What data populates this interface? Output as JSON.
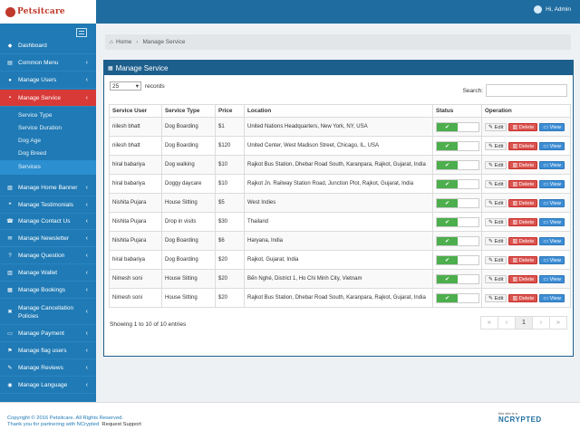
{
  "app": {
    "logo_text": "Petsitcare"
  },
  "header": {
    "user_label": "Hi, Admin"
  },
  "sidebar": {
    "items": [
      {
        "label": "Dashboard",
        "icon": "dashboard-icon",
        "chevron": false
      },
      {
        "label": "Common Menu",
        "icon": "list-icon",
        "chevron": true
      },
      {
        "label": "Manage Users",
        "icon": "users-icon",
        "chevron": true
      },
      {
        "label": "Manage Service",
        "icon": "service-icon",
        "chevron": true,
        "active": true
      },
      {
        "label": "Manage Home Banner",
        "icon": "image-icon",
        "chevron": true
      },
      {
        "label": "Manage Testimonials",
        "icon": "quote-icon",
        "chevron": true
      },
      {
        "label": "Manage Contact Us",
        "icon": "phone-icon",
        "chevron": true
      },
      {
        "label": "Manage Newsletter",
        "icon": "envelope-icon",
        "chevron": true
      },
      {
        "label": "Manage Question",
        "icon": "question-icon",
        "chevron": true
      },
      {
        "label": "Manage Wallet",
        "icon": "wallet-icon",
        "chevron": true
      },
      {
        "label": "Manage Bookings",
        "icon": "calendar-icon",
        "chevron": true
      },
      {
        "label": "Manage Cancellation Policies",
        "icon": "cancel-icon",
        "chevron": true
      },
      {
        "label": "Manage Payment",
        "icon": "payment-icon",
        "chevron": true
      },
      {
        "label": "Manage flag users",
        "icon": "flag-icon",
        "chevron": true
      },
      {
        "label": "Manage Reviews",
        "icon": "comment-icon",
        "chevron": true
      },
      {
        "label": "Manage Language",
        "icon": "globe-icon",
        "chevron": true
      }
    ],
    "subitems": [
      "Service Type",
      "Service Duration",
      "Dog Age",
      "Dog Breed",
      "Services"
    ]
  },
  "breadcrumb": {
    "home": "Home",
    "current": "Manage Service"
  },
  "panel": {
    "title": "Manage Service",
    "length_value": "25",
    "length_suffix": "records",
    "search_label": "Search:",
    "info": "Showing 1 to 10 of 10 entries",
    "pager": [
      "«",
      "‹",
      "1",
      "›",
      "»"
    ]
  },
  "table": {
    "headers": [
      "Service User",
      "Service Type",
      "Price",
      "Location",
      "Status",
      "Operation"
    ],
    "rows": [
      [
        "nilesh bhatt",
        "Dog Boarding",
        "$1",
        "United Nations Headquarters, New York, NY, USA"
      ],
      [
        "nilesh bhatt",
        "Dog Boarding",
        "$120",
        "United Center, West Madison Street, Chicago, IL, USA"
      ],
      [
        "hiral babariya",
        "Dog walking",
        "$10",
        "Rajkot Bus Station, Dhebar Road South, Karanpara, Rajkot, Gujarat, India"
      ],
      [
        "hiral babariya",
        "Doggy daycare",
        "$10",
        "Rajkot Jn. Railway Station Road, Junction Plot, Rajkot, Gujarat, India"
      ],
      [
        "Nishita Pujara",
        "House Sitting",
        "$5",
        "West Indies"
      ],
      [
        "Nishita Pujara",
        "Drop in visits",
        "$30",
        "Thailand"
      ],
      [
        "Nishita Pujara",
        "Dog Boarding",
        "$6",
        "Haryana, India"
      ],
      [
        "hiral babariya",
        "Dog Boarding",
        "$20",
        "Rajkot, Gujarat, India"
      ],
      [
        "Nimesh soni",
        "House Sitting",
        "$20",
        "Bến Nghé, District 1, Ho Chi Minh City, Vietnam"
      ],
      [
        "Nimesh soni",
        "House Sitting",
        "$20",
        "Rajkot Bus Station, Dhebar Road South, Karanpara, Rajkot, Gujarat, India"
      ]
    ],
    "edit_label": "Edit",
    "delete_label": "Delete",
    "view_label": "View",
    "status_on": "✔"
  },
  "footer": {
    "copyright": "Copyright © 2016 Petsitcare. All Rights Reserved.",
    "thanks": "Thank you for partnering with NCrypted",
    "support": "Request Support",
    "brand_small": "this site is a",
    "brand_big": "NCRYPTED"
  },
  "colors": {
    "topbar": "#1f6da0",
    "sidebar": "#1f7ab5",
    "active": "#d83a38",
    "panel_header": "#1d5f8c"
  }
}
